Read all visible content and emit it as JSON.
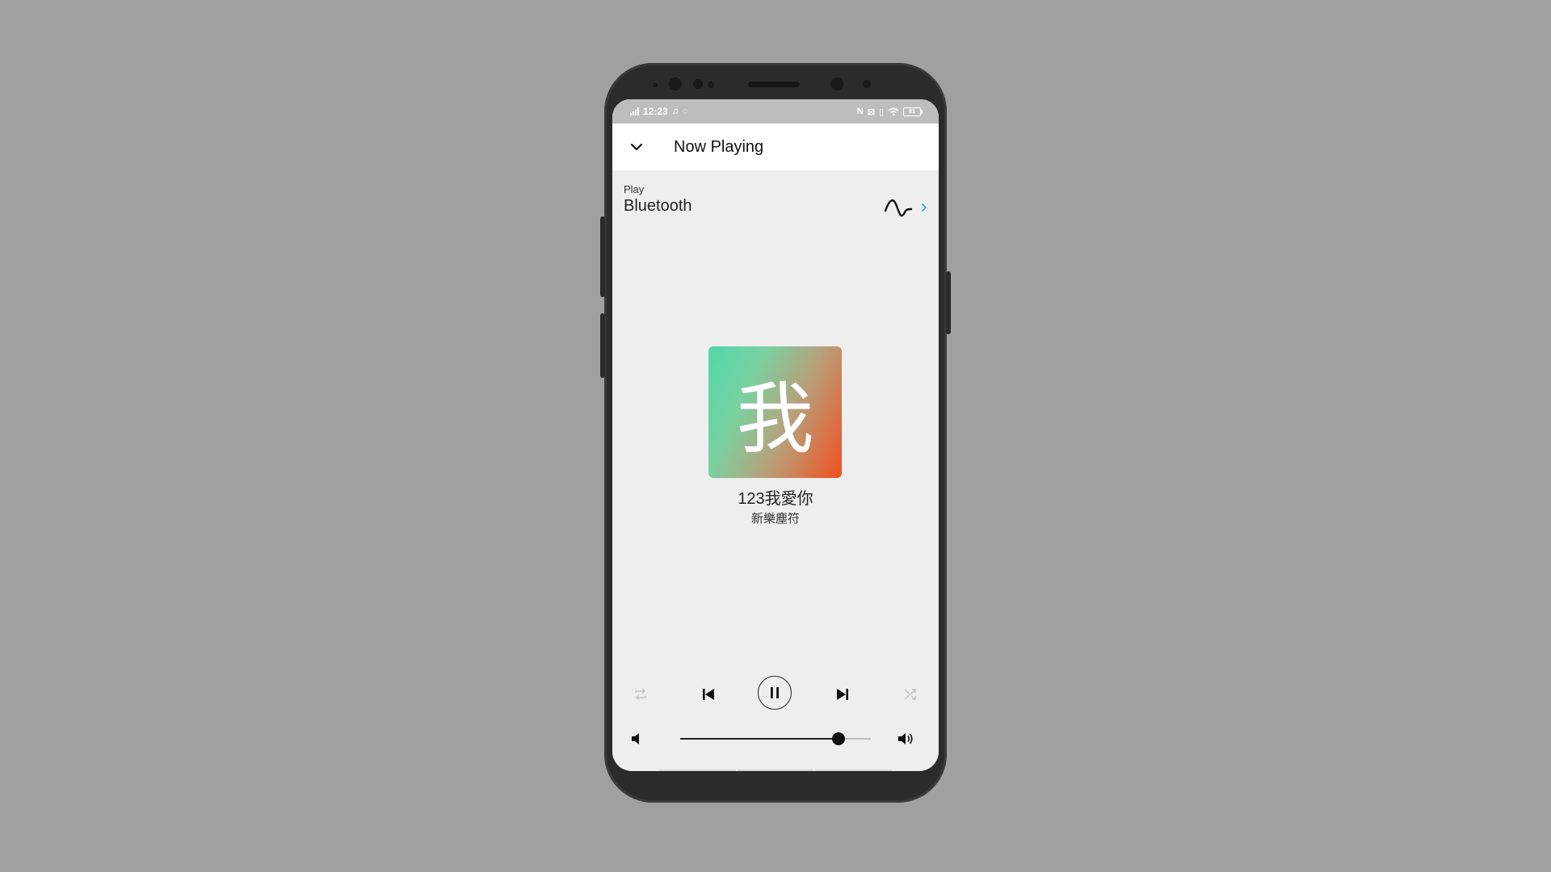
{
  "status_bar": {
    "time": "12:23",
    "battery_label": "81",
    "left_icons": [
      "signal-icon",
      "music-note-icon",
      "whatsapp-icon"
    ],
    "right_icons": [
      "nfc-icon",
      "mute-icon",
      "vibrate-icon",
      "wifi-icon",
      "battery-icon"
    ]
  },
  "header": {
    "title": "Now Playing",
    "back_icon": "chevron-down-icon"
  },
  "source": {
    "kicker": "Play",
    "name": "Bluetooth",
    "wave_icon": "waveform-icon",
    "arrow_icon": "chevron-right-icon",
    "accent_color": "#2aa7d6"
  },
  "track": {
    "album_art_glyph": "我",
    "title": "123我愛你",
    "artist": "新樂塵符"
  },
  "controls": {
    "repeat_icon": "repeat-icon",
    "previous_icon": "skip-previous-icon",
    "pause_icon": "pause-icon",
    "next_icon": "skip-next-icon",
    "shuffle_icon": "shuffle-icon"
  },
  "volume": {
    "level": 0.83,
    "low_icon": "volume-low-icon",
    "high_icon": "volume-high-icon"
  }
}
